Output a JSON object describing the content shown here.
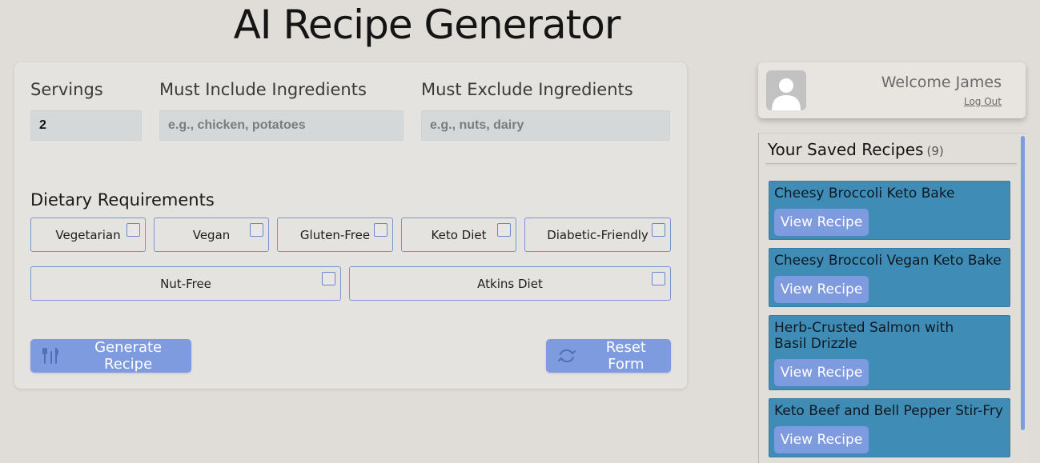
{
  "app": {
    "title": "AI Recipe Generator"
  },
  "form": {
    "servings_label": "Servings",
    "servings_value": "2",
    "include_label": "Must Include Ingredients",
    "include_placeholder": "e.g., chicken, potatoes",
    "exclude_label": "Must Exclude Ingredients",
    "exclude_placeholder": "e.g., nuts, dairy",
    "dietary_label": "Dietary Requirements",
    "dietary_options": [
      {
        "label": "Vegetarian",
        "checked": false
      },
      {
        "label": "Vegan",
        "checked": false
      },
      {
        "label": "Gluten-Free",
        "checked": false
      },
      {
        "label": "Keto Diet",
        "checked": false
      },
      {
        "label": "Diabetic-Friendly",
        "checked": false
      },
      {
        "label": "Nut-Free",
        "checked": false
      },
      {
        "label": "Atkins Diet",
        "checked": false
      }
    ],
    "generate_label": "Generate Recipe",
    "generate_icon": "utensils-icon",
    "reset_label": "Reset Form",
    "reset_icon": "refresh-icon"
  },
  "user": {
    "welcome": "Welcome James",
    "logout_label": "Log Out",
    "avatar_icon": "user-avatar-icon"
  },
  "saved": {
    "heading": "Your Saved Recipes",
    "count": "(9)",
    "recipes": [
      {
        "name": "Cheesy Broccoli Keto Bake",
        "view_label": "View Recipe"
      },
      {
        "name": "Cheesy Broccoli Vegan Keto Bake",
        "view_label": "View Recipe"
      },
      {
        "name": "Herb-Crusted Salmon with Basil Drizzle",
        "view_label": "View Recipe"
      },
      {
        "name": "Keto Beef and Bell Pepper Stir-Fry",
        "view_label": "View Recipe"
      }
    ]
  },
  "colors": {
    "accent": "#7e9be0",
    "recipe_card": "#3f8db6",
    "background": "#e0ddd8"
  }
}
